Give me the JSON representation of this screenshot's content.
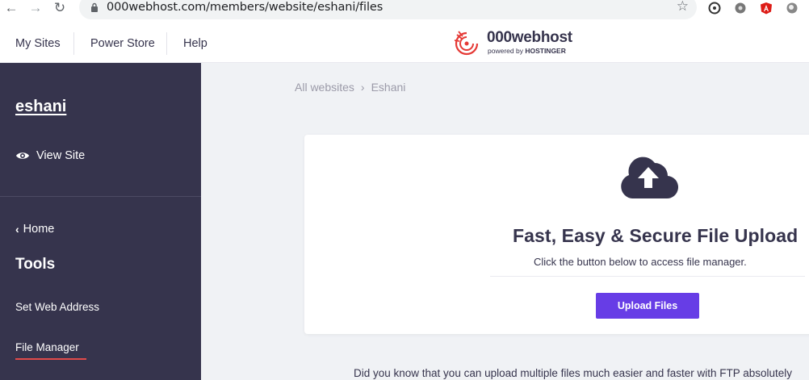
{
  "browser": {
    "url": "000webhost.com/members/website/eshani/files"
  },
  "topnav": {
    "items": [
      "My Sites",
      "Power Store",
      "Help"
    ]
  },
  "logo": {
    "name": "000webhost",
    "powered_by": "powered by",
    "brand": "HOSTINGER"
  },
  "sidebar": {
    "site_name": "eshani",
    "view_site": "View Site",
    "home": "Home",
    "tools_title": "Tools",
    "items": [
      "Set Web Address",
      "File Manager"
    ]
  },
  "breadcrumb": {
    "root": "All websites",
    "separator": "›",
    "current": "Eshani"
  },
  "card": {
    "title": "Fast, Easy & Secure File Upload",
    "subtitle": "Click the button below to access file manager.",
    "button": "Upload Files"
  },
  "tip": "Did you know that you can upload multiple files much easier and faster with FTP absolutely",
  "colors": {
    "sidebar_bg": "#36344d",
    "accent_purple": "#673de6",
    "active_underline": "#e24b4b"
  },
  "icons": [
    "lock-icon",
    "star-icon",
    "eye-icon",
    "cloud-upload-icon",
    "chevron-left-icon"
  ]
}
